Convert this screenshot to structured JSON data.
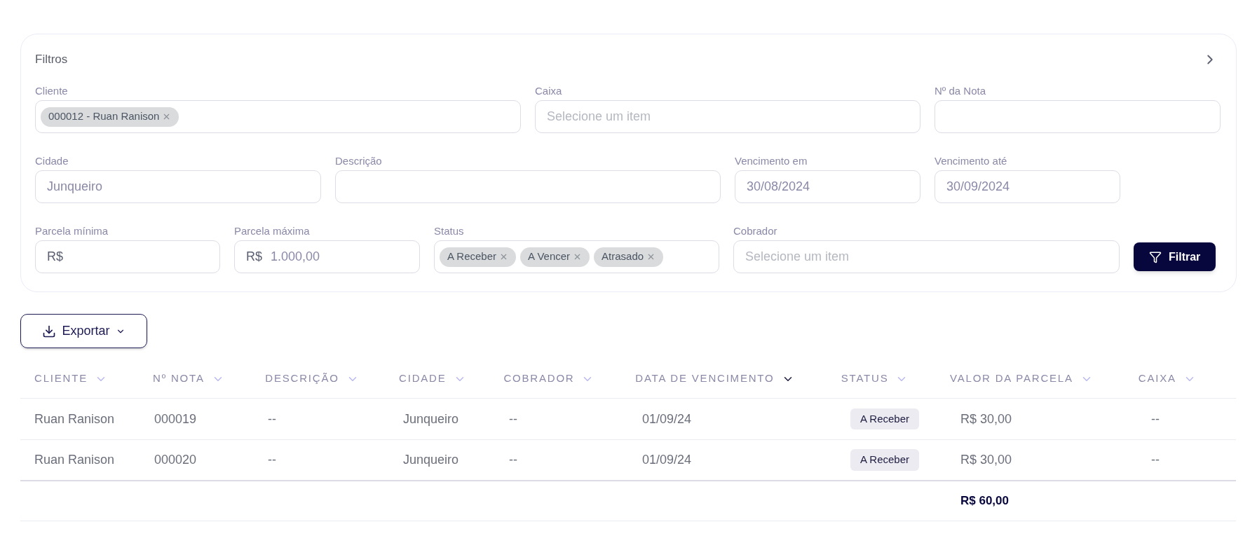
{
  "filters": {
    "title": "Filtros",
    "fields": [
      {
        "kind": "tags",
        "label": "Cliente",
        "tags": [
          "000012 - Ruan Ranison"
        ]
      },
      {
        "kind": "text",
        "label": "Caixa",
        "placeholder": "Selecione um item"
      },
      {
        "kind": "text",
        "label": "Nº da Nota"
      },
      {
        "kind": "text",
        "label": "Cidade",
        "value": "Junqueiro"
      },
      {
        "kind": "text",
        "label": "Descrição"
      },
      {
        "kind": "text",
        "label": "Vencimento em",
        "value": "30/08/2024"
      },
      {
        "kind": "text",
        "label": "Vencimento até",
        "value": "30/09/2024"
      },
      {
        "kind": "money",
        "label": "Parcela mínima",
        "prefix": "R$"
      },
      {
        "kind": "money",
        "label": "Parcela máxima",
        "prefix": "R$",
        "value": "1.000,00"
      },
      {
        "kind": "tags",
        "label": "Status",
        "tags": [
          "A Receber",
          "A Vencer",
          "Atrasado"
        ]
      },
      {
        "kind": "text",
        "label": "Cobrador",
        "placeholder": "Selecione um item"
      }
    ],
    "button": "Filtrar"
  },
  "export_button": "Exportar",
  "table": {
    "columns": [
      {
        "label": "CLIENTE",
        "sorted": false
      },
      {
        "label": "Nº NOTA",
        "sorted": false
      },
      {
        "label": "DESCRIÇÃO",
        "sorted": false
      },
      {
        "label": "CIDADE",
        "sorted": false
      },
      {
        "label": "COBRADOR",
        "sorted": false
      },
      {
        "label": "DATA DE VENCIMENTO",
        "sorted": true
      },
      {
        "label": "STATUS",
        "sorted": false
      },
      {
        "label": "VALOR DA PARCELA",
        "sorted": false
      },
      {
        "label": "CAIXA",
        "sorted": false
      }
    ],
    "rows": [
      [
        "Ruan Ranison",
        "000019",
        "--",
        "Junqueiro",
        "--",
        "01/09/24",
        "A Receber",
        "R$ 30,00",
        "--"
      ],
      [
        "Ruan Ranison",
        "000020",
        "--",
        "Junqueiro",
        "--",
        "01/09/24",
        "A Receber",
        "R$ 30,00",
        "--"
      ]
    ],
    "total": "R$ 60,00"
  }
}
